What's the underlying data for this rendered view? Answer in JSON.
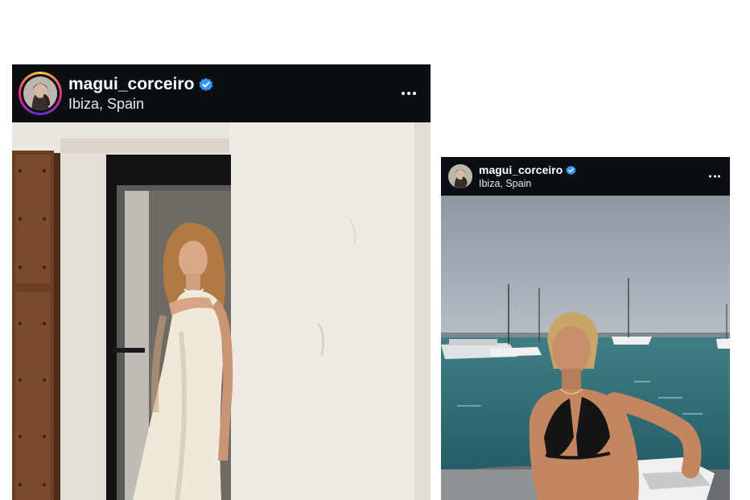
{
  "posts": [
    {
      "username": "magui_corceiro",
      "location": "Ibiza, Spain",
      "verified": true,
      "avatar_icon": "profile-photo-avatar",
      "more_icon": "more-horizontal-icon",
      "story_ring": true
    },
    {
      "username": "magui_corceiro",
      "location": "Ibiza, Spain",
      "verified": true,
      "avatar_icon": "profile-photo-avatar",
      "more_icon": "more-horizontal-icon",
      "story_ring": false
    }
  ],
  "colors": {
    "header_bg": "#0b0f14",
    "verified_blue": "#3897f0",
    "text": "#ffffff"
  }
}
